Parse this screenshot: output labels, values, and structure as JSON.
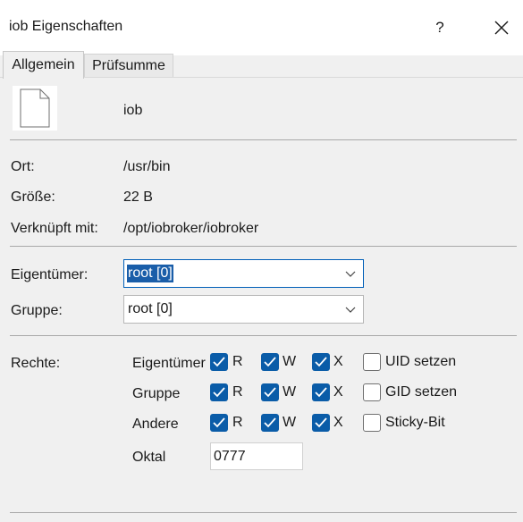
{
  "window": {
    "title": "iob Eigenschaften",
    "help_label": "?",
    "close_icon": "close-icon"
  },
  "tabs": [
    {
      "label": "Allgemein",
      "active": true
    },
    {
      "label": "Prüfsumme",
      "active": false
    }
  ],
  "file": {
    "icon": "file-icon",
    "name": "iob"
  },
  "info": {
    "ort_label": "Ort:",
    "ort_value": "/usr/bin",
    "size_label": "Größe:",
    "size_value": "22 B",
    "link_label": "Verknüpft mit:",
    "link_value": "/opt/iobroker/iobroker"
  },
  "ownership": {
    "owner_label": "Eigentümer:",
    "owner_value": "root [0]",
    "group_label": "Gruppe:",
    "group_value": "root [0]"
  },
  "rights": {
    "label": "Rechte:",
    "rows": [
      {
        "label": "Eigentümer",
        "r": true,
        "w": true,
        "x": true,
        "special_label": "UID setzen",
        "special": false
      },
      {
        "label": "Gruppe",
        "r": true,
        "w": true,
        "x": true,
        "special_label": "GID setzen",
        "special": false
      },
      {
        "label": "Andere",
        "r": true,
        "w": true,
        "x": true,
        "special_label": "Sticky-Bit",
        "special": false
      }
    ],
    "r_label": "R",
    "w_label": "W",
    "x_label": "X",
    "octal_label": "Oktal",
    "octal_value": "0777"
  },
  "colors": {
    "accent": "#0a5ca8",
    "selection": "#1a5ea9"
  }
}
